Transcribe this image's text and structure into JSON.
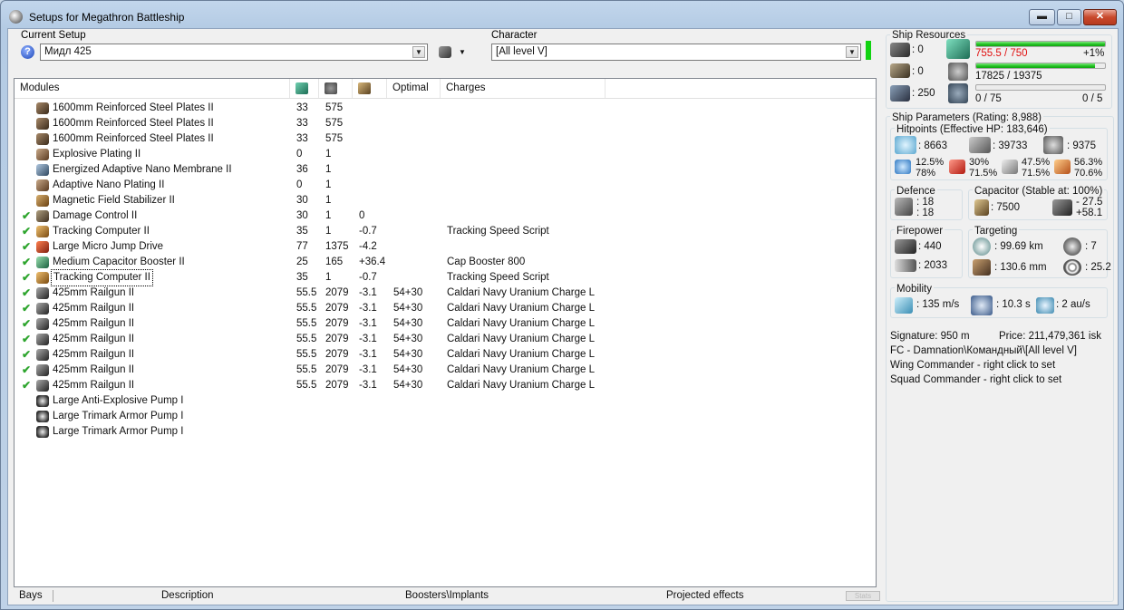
{
  "window": {
    "title": "Setups for Megathron Battleship",
    "min": "▬",
    "max": "□",
    "close": "✕"
  },
  "current_setup": {
    "label": "Current Setup",
    "value": "Мидл 425",
    "help": "?"
  },
  "character": {
    "label": "Character",
    "value": "[All level V]"
  },
  "modules_table": {
    "headers": [
      "Modules",
      "",
      "",
      "",
      "Optimal",
      "Charges"
    ],
    "header_icons": [
      "cpu-icon",
      "powergrid-icon",
      "capacitor-use-icon"
    ],
    "rows": [
      {
        "name": "1600mm Reinforced Steel Plates II",
        "icon": "armor-plate-icon",
        "active": false,
        "cpu": "33",
        "pg": "575",
        "cap": "",
        "optimal": "",
        "charges": ""
      },
      {
        "name": "1600mm Reinforced Steel Plates II",
        "icon": "armor-plate-icon",
        "active": false,
        "cpu": "33",
        "pg": "575",
        "cap": "",
        "optimal": "",
        "charges": ""
      },
      {
        "name": "1600mm Reinforced Steel Plates II",
        "icon": "armor-plate-icon",
        "active": false,
        "cpu": "33",
        "pg": "575",
        "cap": "",
        "optimal": "",
        "charges": ""
      },
      {
        "name": "Explosive Plating II",
        "icon": "plating-icon",
        "active": false,
        "cpu": "0",
        "pg": "1",
        "cap": "",
        "optimal": "",
        "charges": ""
      },
      {
        "name": "Energized Adaptive Nano Membrane II",
        "icon": "membrane-icon",
        "active": false,
        "cpu": "36",
        "pg": "1",
        "cap": "",
        "optimal": "",
        "charges": ""
      },
      {
        "name": "Adaptive Nano Plating II",
        "icon": "plating-icon",
        "active": false,
        "cpu": "0",
        "pg": "1",
        "cap": "",
        "optimal": "",
        "charges": ""
      },
      {
        "name": "Magnetic Field Stabilizer II",
        "icon": "stabilizer-icon",
        "active": false,
        "cpu": "30",
        "pg": "1",
        "cap": "",
        "optimal": "",
        "charges": ""
      },
      {
        "name": "Damage Control II",
        "icon": "damage-control-icon",
        "active": true,
        "cpu": "30",
        "pg": "1",
        "cap": "0",
        "optimal": "",
        "charges": ""
      },
      {
        "name": "Tracking Computer II",
        "icon": "tracking-computer-icon",
        "active": true,
        "cpu": "35",
        "pg": "1",
        "cap": "-0.7",
        "optimal": "",
        "charges": "Tracking Speed Script"
      },
      {
        "name": "Large Micro Jump Drive",
        "icon": "micro-jump-drive-icon",
        "active": true,
        "cpu": "77",
        "pg": "1375",
        "cap": "-4.2",
        "optimal": "",
        "charges": ""
      },
      {
        "name": "Medium Capacitor Booster II",
        "icon": "capacitor-booster-icon",
        "active": true,
        "cpu": "25",
        "pg": "165",
        "cap": "+36.4",
        "optimal": "",
        "charges": "Cap Booster 800"
      },
      {
        "name": "Tracking Computer II",
        "icon": "tracking-computer-icon",
        "active": true,
        "focused": true,
        "cpu": "35",
        "pg": "1",
        "cap": "-0.7",
        "optimal": "",
        "charges": "Tracking Speed Script"
      },
      {
        "name": "425mm Railgun II",
        "icon": "railgun-icon",
        "active": true,
        "cpu": "55.5",
        "pg": "2079",
        "cap": "-3.1",
        "optimal": "54+30",
        "charges": "Caldari Navy Uranium Charge L"
      },
      {
        "name": "425mm Railgun II",
        "icon": "railgun-icon",
        "active": true,
        "cpu": "55.5",
        "pg": "2079",
        "cap": "-3.1",
        "optimal": "54+30",
        "charges": "Caldari Navy Uranium Charge L"
      },
      {
        "name": "425mm Railgun II",
        "icon": "railgun-icon",
        "active": true,
        "cpu": "55.5",
        "pg": "2079",
        "cap": "-3.1",
        "optimal": "54+30",
        "charges": "Caldari Navy Uranium Charge L"
      },
      {
        "name": "425mm Railgun II",
        "icon": "railgun-icon",
        "active": true,
        "cpu": "55.5",
        "pg": "2079",
        "cap": "-3.1",
        "optimal": "54+30",
        "charges": "Caldari Navy Uranium Charge L"
      },
      {
        "name": "425mm Railgun II",
        "icon": "railgun-icon",
        "active": true,
        "cpu": "55.5",
        "pg": "2079",
        "cap": "-3.1",
        "optimal": "54+30",
        "charges": "Caldari Navy Uranium Charge L"
      },
      {
        "name": "425mm Railgun II",
        "icon": "railgun-icon",
        "active": true,
        "cpu": "55.5",
        "pg": "2079",
        "cap": "-3.1",
        "optimal": "54+30",
        "charges": "Caldari Navy Uranium Charge L"
      },
      {
        "name": "425mm Railgun II",
        "icon": "railgun-icon",
        "active": true,
        "cpu": "55.5",
        "pg": "2079",
        "cap": "-3.1",
        "optimal": "54+30",
        "charges": "Caldari Navy Uranium Charge L"
      },
      {
        "name": "Large Anti-Explosive Pump I",
        "icon": "rig-icon",
        "active": false,
        "cpu": "",
        "pg": "",
        "cap": "",
        "optimal": "",
        "charges": ""
      },
      {
        "name": "Large Trimark Armor Pump I",
        "icon": "rig-icon",
        "active": false,
        "cpu": "",
        "pg": "",
        "cap": "",
        "optimal": "",
        "charges": ""
      },
      {
        "name": "Large Trimark Armor Pump I",
        "icon": "rig-icon",
        "active": false,
        "cpu": "",
        "pg": "",
        "cap": "",
        "optimal": "",
        "charges": ""
      }
    ]
  },
  "bottom_tabs": {
    "bays": "Bays",
    "description": "Description",
    "boosters": "Boosters\\Implants",
    "projected": "Projected effects",
    "stats": "Stats"
  },
  "ship_resources": {
    "title": "Ship Resources",
    "turret_slots": ": 0",
    "launcher_slots": ": 0",
    "drone_bay": ": 250",
    "cpu": {
      "text": "755.5 / 750",
      "pct_text": "+1%",
      "fill": 1.0
    },
    "powergrid": {
      "text": "17825 / 19375",
      "fill": 0.92
    },
    "drones": {
      "left": "0 / 75",
      "right": "0 / 5",
      "fill": 0.0
    },
    "danger_color": "#e01010"
  },
  "ship_parameters": {
    "title": "Ship Parameters (Rating: 8,988)",
    "hitpoints_title": "Hitpoints (Effective HP: 183,646)",
    "shield_hp": ": 8663",
    "armor_hp": ": 39733",
    "structure_hp": ": 9375",
    "resists": [
      {
        "top": "12.5%",
        "bottom": "78%"
      },
      {
        "top": "30%",
        "bottom": "71.5%"
      },
      {
        "top": "47.5%",
        "bottom": "71.5%"
      },
      {
        "top": "56.3%",
        "bottom": "70.6%"
      }
    ],
    "defence": {
      "title": "Defence",
      "a": ": 18",
      "b": ": 18"
    },
    "capacitor": {
      "title": "Capacitor (Stable at: 100%)",
      "amount": ": 7500",
      "delta_neg": "- 27.5",
      "delta_pos": "+58.1"
    },
    "firepower": {
      "title": "Firepower",
      "dps": ": 440",
      "volley": ": 2033"
    },
    "targeting": {
      "title": "Targeting",
      "range": ": 99.69 km",
      "targets": ": 7",
      "sensor": ": 130.6 mm",
      "scan": ": 25.2"
    },
    "mobility": {
      "title": "Mobility",
      "speed": ": 135 m/s",
      "align": ": 10.3 s",
      "warp": ": 2 au/s"
    }
  },
  "info": {
    "signature": "Signature: 950 m",
    "price": "Price: 211,479,361 isk",
    "fleet": "FC - Damnation\\Командный\\[All level V]",
    "wing": "Wing Commander - right click to set",
    "squad": "Squad Commander - right click to set"
  }
}
